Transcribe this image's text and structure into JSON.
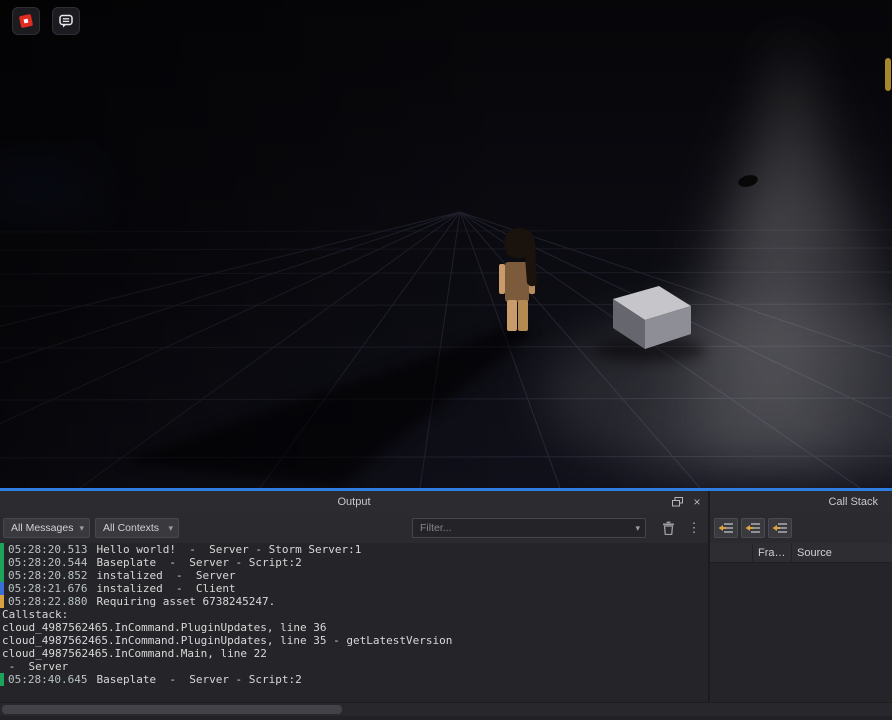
{
  "viewport": {
    "buttons": {
      "roblox_menu": "roblox-menu",
      "chat": "chat"
    }
  },
  "output": {
    "title": "Output",
    "toolbar": {
      "messages_dropdown": "All Messages",
      "contexts_dropdown": "All Contexts",
      "filter_placeholder": "Filter..."
    },
    "log": [
      {
        "severity": "green",
        "time": "05:28:20.513",
        "message": "Hello world!  -  Server - Storm Server:1"
      },
      {
        "severity": "green",
        "time": "05:28:20.544",
        "message": "Baseplate  -  Server - Script:2"
      },
      {
        "severity": "green",
        "time": "05:28:20.852",
        "message": "instalized  -  Server"
      },
      {
        "severity": "blue",
        "time": "05:28:21.676",
        "message": "instalized  -  Client"
      },
      {
        "severity": "orange",
        "time": "05:28:22.880",
        "message": "Requiring asset 6738245247."
      },
      {
        "severity": "none",
        "time": "",
        "message": "Callstack:"
      },
      {
        "severity": "none",
        "time": "",
        "message": "cloud_4987562465.InCommand.PluginUpdates, line 36"
      },
      {
        "severity": "none",
        "time": "",
        "message": "cloud_4987562465.InCommand.PluginUpdates, line 35 - getLatestVersion"
      },
      {
        "severity": "none",
        "time": "",
        "message": "cloud_4987562465.InCommand.Main, line 22"
      },
      {
        "severity": "none",
        "time": "",
        "message": " -  Server"
      },
      {
        "severity": "green",
        "time": "05:28:40.645",
        "message": "Baseplate  -  Server - Script:2"
      }
    ]
  },
  "call_stack": {
    "title": "Call Stack",
    "columns": [
      "",
      "Fra…",
      "Source"
    ]
  },
  "icons": {
    "close": "×",
    "kebab": "⋮",
    "dropdown_chevron": "▾"
  },
  "colors": {
    "dock_highlight": "#2e7de2",
    "severity": {
      "green": "#1ea35a",
      "blue": "#3a6fd8",
      "orange": "#d9a43f",
      "none": "transparent"
    },
    "timestamp": "#b9c2c6",
    "message": "#d8d8d8"
  }
}
